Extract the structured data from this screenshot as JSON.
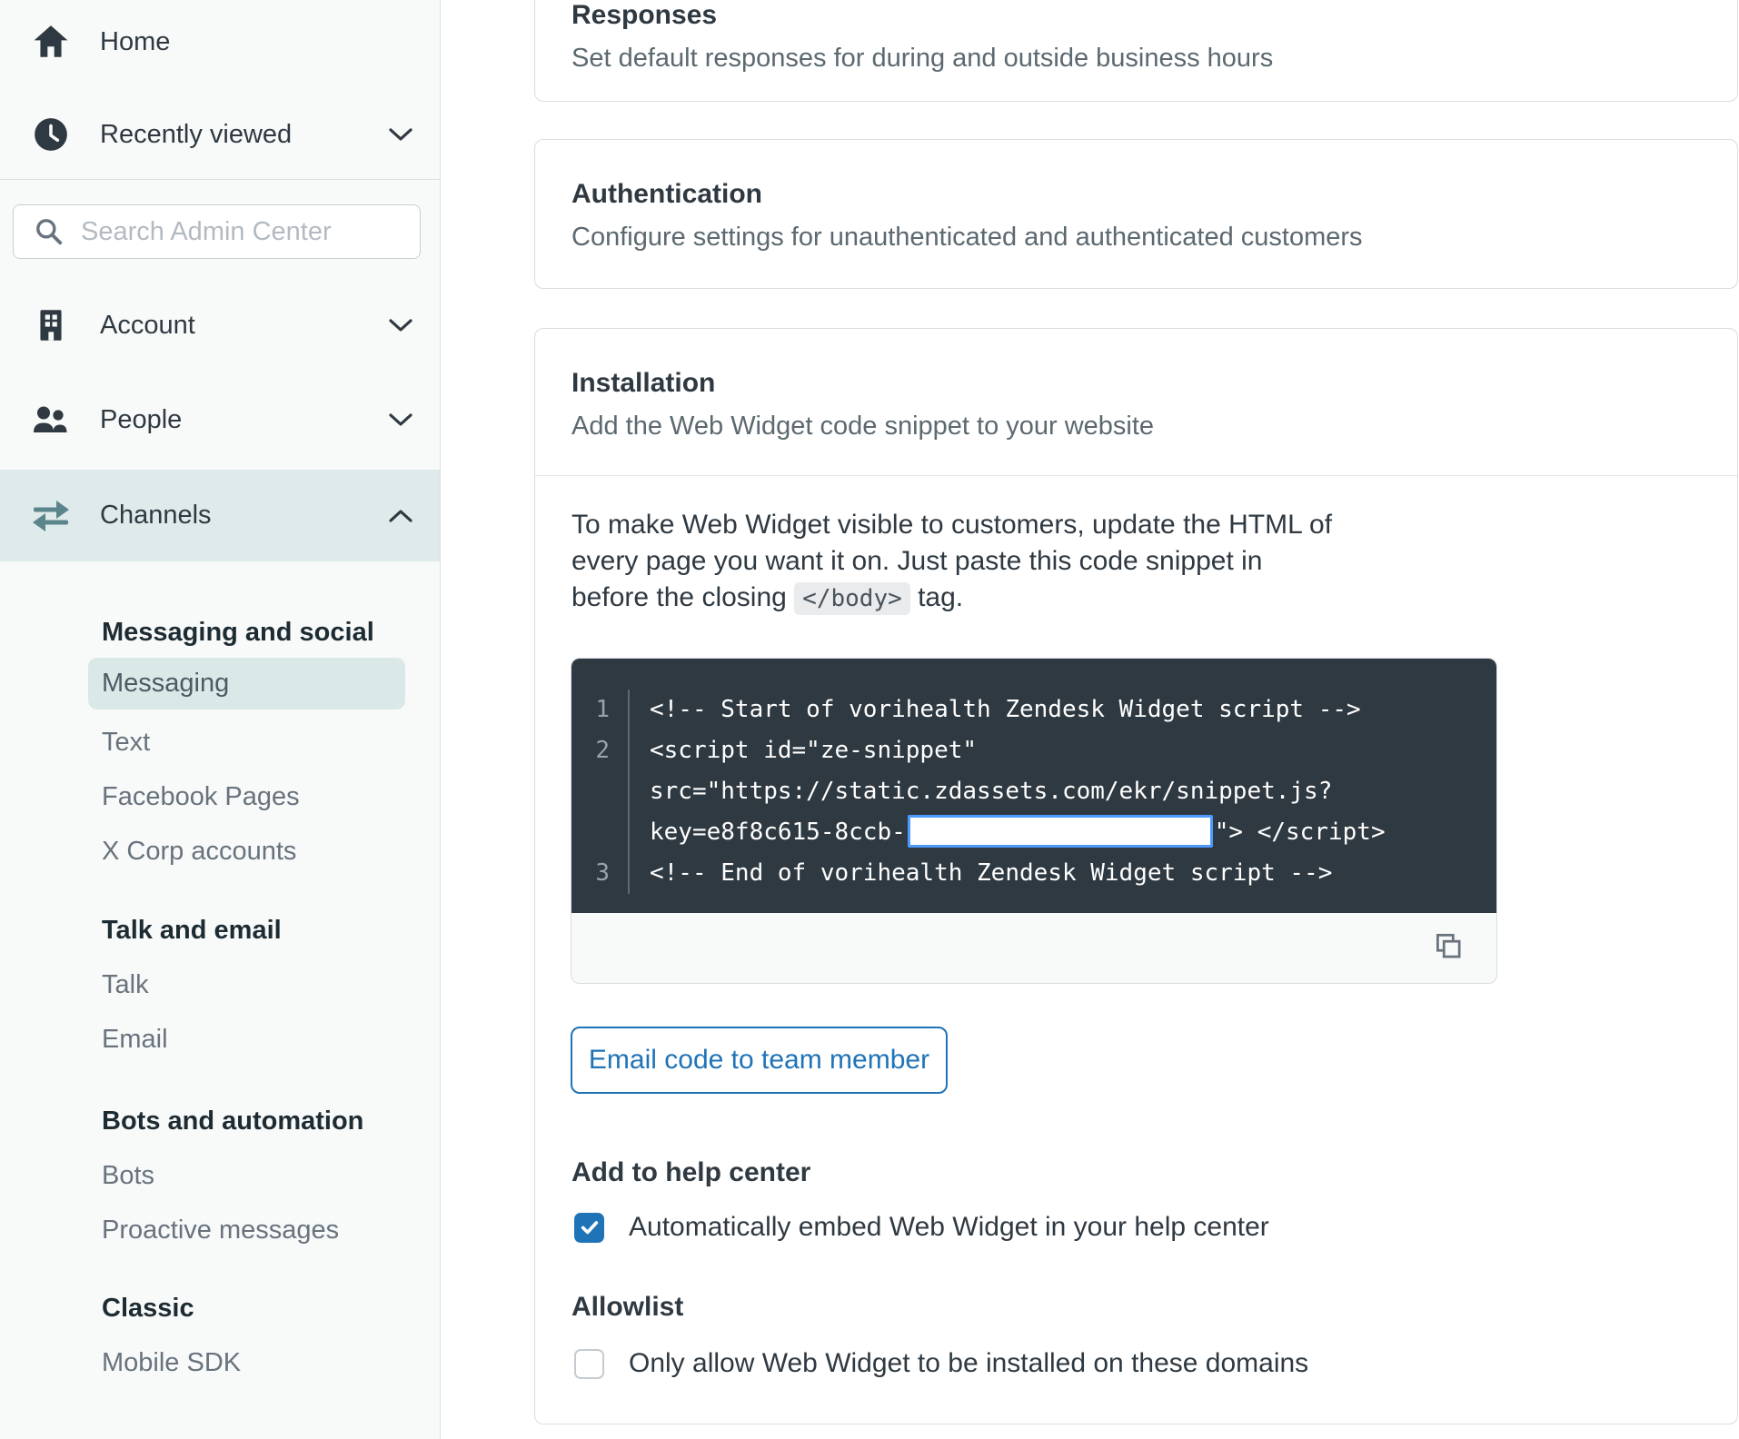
{
  "colors": {
    "accent_blue": "#1f73b7",
    "redaction_border": "#4c9aff",
    "code_background": "#2f3941",
    "sidebar_background": "#f8f9f9",
    "selected_nav_background": "#dfeaea",
    "selected_subnav_background": "#dbe8e8"
  },
  "sidebar": {
    "home_label": "Home",
    "recently_viewed_label": "Recently viewed",
    "search_placeholder": "Search Admin Center",
    "account_label": "Account",
    "people_label": "People",
    "channels_label": "Channels",
    "selected_item": "Messaging",
    "sections": [
      {
        "header": "Messaging and social",
        "items": [
          "Messaging",
          "Text",
          "Facebook Pages",
          "X Corp accounts"
        ]
      },
      {
        "header": "Talk and email",
        "items": [
          "Talk",
          "Email"
        ]
      },
      {
        "header": "Bots and automation",
        "items": [
          "Bots",
          "Proactive messages"
        ]
      },
      {
        "header": "Classic",
        "items": [
          "Mobile SDK"
        ]
      }
    ]
  },
  "responses_card": {
    "title": "Responses",
    "description": "Set default responses for during and outside business hours"
  },
  "authentication_card": {
    "title": "Authentication",
    "description": "Configure settings for unauthenticated and authenticated customers"
  },
  "installation_card": {
    "title": "Installation",
    "description": "Add the Web Widget code snippet to your website",
    "intro": {
      "line1": "To make Web Widget visible to customers, update the HTML of",
      "line2": "every page you want it on. Just paste this code snippet in",
      "line3_before": "before the closing",
      "inline_code": "</body>",
      "line3_after": "tag."
    },
    "code": {
      "lines": [
        {
          "num": "1",
          "text": "<!-- Start of vorihealth Zendesk Widget script -->"
        },
        {
          "num": "2",
          "text": "<script id=\"ze-snippet\""
        },
        {
          "num": "",
          "text": "src=\"https://static.zdassets.com/ekr/snippet.js?"
        },
        {
          "num": "",
          "before_redaction": "key=e8f8c615-8ccb-",
          "after_redaction": "\"> </script>"
        },
        {
          "num": "3",
          "text": "<!-- End of vorihealth Zendesk Widget script -->"
        }
      ]
    },
    "email_button_label": "Email code to team member",
    "help_center": {
      "heading": "Add to help center",
      "checkbox_label": "Automatically embed Web Widget in your help center",
      "checked": true
    },
    "allowlist": {
      "heading": "Allowlist",
      "checkbox_label": "Only allow Web Widget to be installed on these domains",
      "checked": false
    }
  }
}
